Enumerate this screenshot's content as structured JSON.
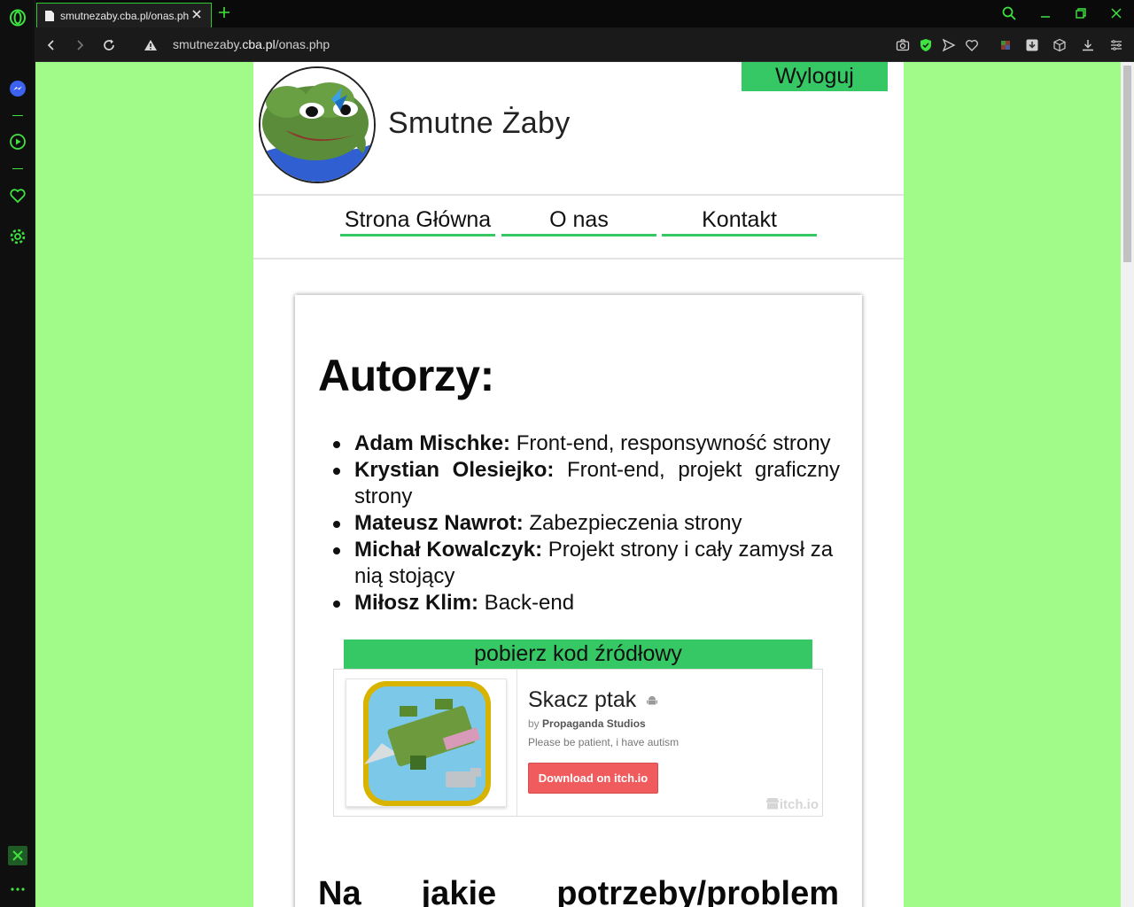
{
  "browser": {
    "tab_title": "smutnezaby.cba.pl/onas.php",
    "url_prefix": "smutnezaby.",
    "url_domain": "cba.pl",
    "url_path": "/onas.php",
    "accent_color": "#2ecc2e"
  },
  "sidebar": {
    "items": [
      "opera-logo",
      "messenger-icon",
      "player-icon",
      "heart-icon",
      "settings-icon",
      "extension-icon",
      "more-icon"
    ]
  },
  "site": {
    "title": "Smutne Żaby",
    "logout_label": "Wyloguj",
    "background_color": "#a0fb88",
    "button_color": "#35c865",
    "nav": [
      {
        "label": "Strona Główna"
      },
      {
        "label": "O nas"
      },
      {
        "label": "Kontakt"
      }
    ]
  },
  "content": {
    "authors_heading": "Autorzy:",
    "authors": [
      {
        "name": "Adam Mischke:",
        "role": " Front-end, responsywność strony"
      },
      {
        "name": "Krystian Olesiejko:",
        "role": " Front-end, projekt graficzny strony"
      },
      {
        "name": "Mateusz Nawrot:",
        "role": " Zabezpieczenia strony"
      },
      {
        "name": "Michał Kowalczyk:",
        "role": " Projekt strony i cały zamysł za nią stojący"
      },
      {
        "name": "Miłosz Klim:",
        "role": " Back-end"
      }
    ],
    "download_source_label": "pobierz kod źródłowy",
    "next_heading": "Na jakie potrzeby/problem"
  },
  "itch_widget": {
    "game_title": "Skacz ptak",
    "by_prefix": "by",
    "author": "Propaganda Studios",
    "description": "Please be patient, i have autism",
    "download_label": "Download on itch.io",
    "brand": "itch.io"
  }
}
